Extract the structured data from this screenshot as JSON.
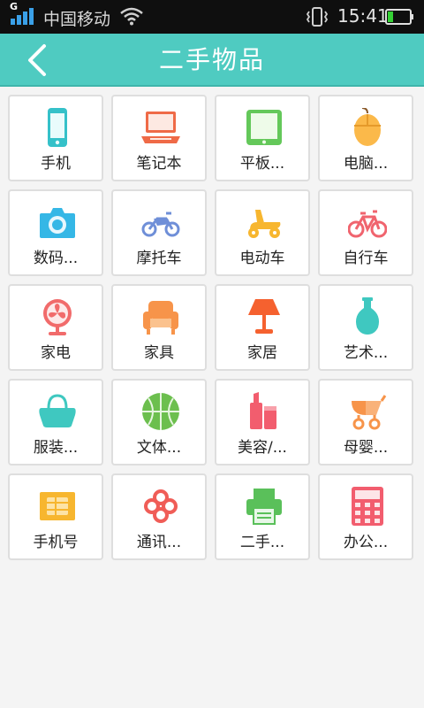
{
  "status_bar": {
    "network_type": "G",
    "carrier": "中国移动",
    "time": "15:41",
    "icons": [
      "signal-icon",
      "wifi-icon",
      "vibrate-icon",
      "battery-icon"
    ]
  },
  "header": {
    "title": "二手物品",
    "back_icon": "chevron-left-icon",
    "background_color": "#4fcbc1"
  },
  "categories": [
    {
      "label": "手机",
      "icon": "phone-icon"
    },
    {
      "label": "笔记本",
      "icon": "laptop-icon"
    },
    {
      "label": "平板...",
      "icon": "tablet-icon"
    },
    {
      "label": "电脑...",
      "icon": "mouse-icon"
    },
    {
      "label": "数码...",
      "icon": "camera-icon"
    },
    {
      "label": "摩托车",
      "icon": "motorcycle-icon"
    },
    {
      "label": "电动车",
      "icon": "scooter-icon"
    },
    {
      "label": "自行车",
      "icon": "bicycle-icon"
    },
    {
      "label": "家电",
      "icon": "fan-icon"
    },
    {
      "label": "家具",
      "icon": "sofa-icon"
    },
    {
      "label": "家居",
      "icon": "lamp-icon"
    },
    {
      "label": "艺术...",
      "icon": "vase-icon"
    },
    {
      "label": "服装...",
      "icon": "handbag-icon"
    },
    {
      "label": "文体...",
      "icon": "ball-icon"
    },
    {
      "label": "美容/...",
      "icon": "cosmetics-icon"
    },
    {
      "label": "母婴...",
      "icon": "stroller-icon"
    },
    {
      "label": "手机号",
      "icon": "sim-card-icon"
    },
    {
      "label": "通讯...",
      "icon": "unicom-knot-icon"
    },
    {
      "label": "二手...",
      "icon": "printer-icon"
    },
    {
      "label": "办公...",
      "icon": "calculator-icon"
    }
  ]
}
